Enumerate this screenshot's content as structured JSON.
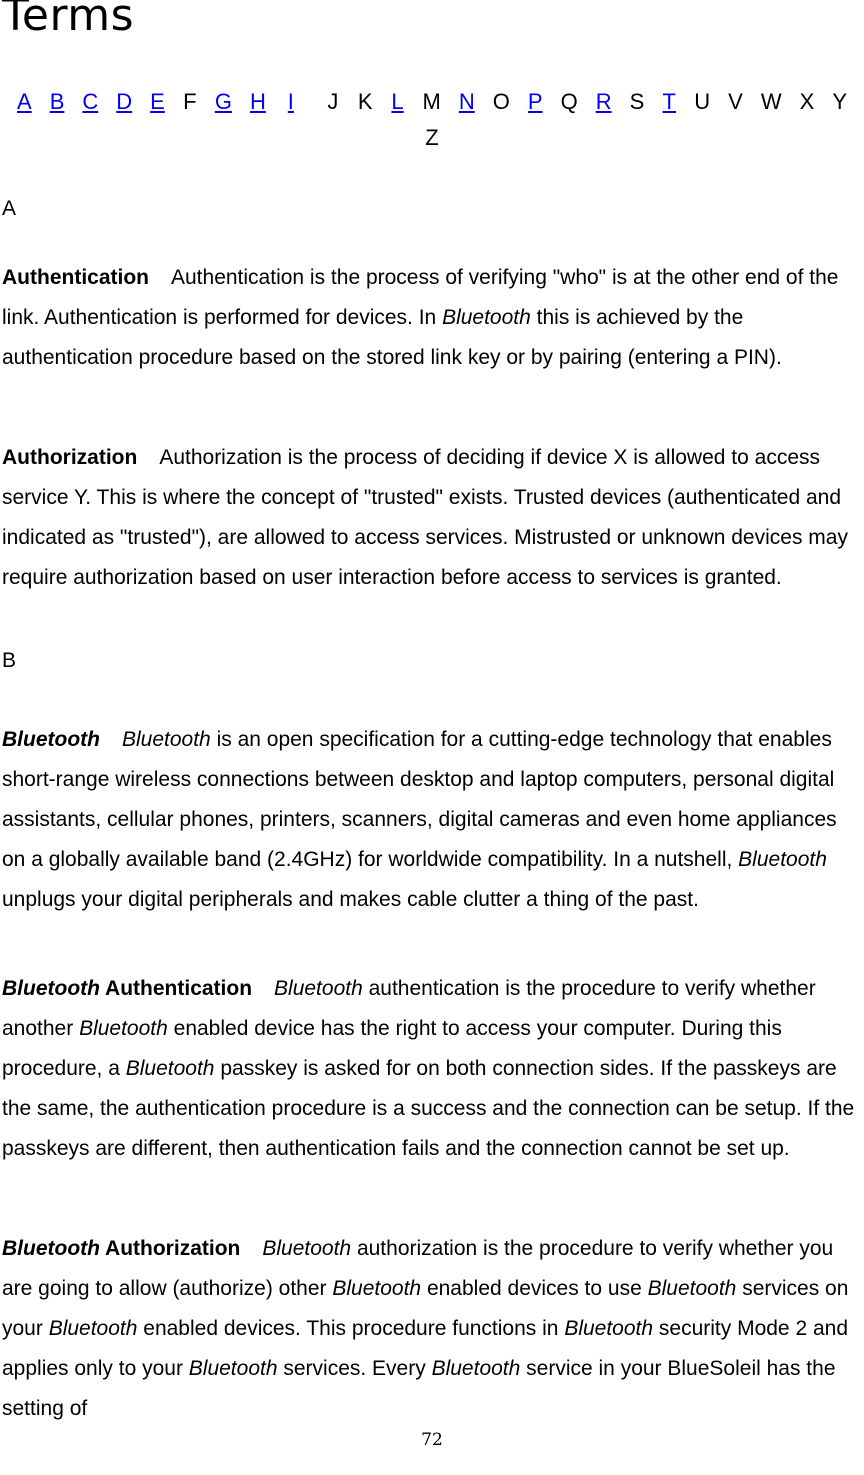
{
  "document": {
    "title": "Terms",
    "page_number": "72",
    "link_color": "#0000ee",
    "text_color": "#000000",
    "background_color": "#ffffff"
  },
  "alphabet_index": {
    "name": "alphabet-index",
    "letters": [
      {
        "label": "A",
        "is_link": true
      },
      {
        "label": "B",
        "is_link": true
      },
      {
        "label": "C",
        "is_link": true
      },
      {
        "label": "D",
        "is_link": true
      },
      {
        "label": "E",
        "is_link": true
      },
      {
        "label": "F",
        "is_link": false
      },
      {
        "label": "G",
        "is_link": true
      },
      {
        "label": "H",
        "is_link": true
      },
      {
        "label": "I",
        "is_link": true
      },
      {
        "label": "J",
        "is_link": false
      },
      {
        "label": "K",
        "is_link": false
      },
      {
        "label": "L",
        "is_link": true
      },
      {
        "label": "M",
        "is_link": false
      },
      {
        "label": "N",
        "is_link": true
      },
      {
        "label": "O",
        "is_link": false
      },
      {
        "label": "P",
        "is_link": true
      },
      {
        "label": "Q",
        "is_link": false
      },
      {
        "label": "R",
        "is_link": true
      },
      {
        "label": "S",
        "is_link": false
      },
      {
        "label": "T",
        "is_link": true
      },
      {
        "label": "U",
        "is_link": false
      },
      {
        "label": "V",
        "is_link": false
      },
      {
        "label": "W",
        "is_link": false
      },
      {
        "label": "X",
        "is_link": false
      },
      {
        "label": "Y",
        "is_link": false
      },
      {
        "label": "Z",
        "is_link": false
      }
    ]
  },
  "sections": {
    "a": {
      "heading": "A"
    },
    "b": {
      "heading": "B"
    }
  },
  "entries": {
    "authentication": {
      "term": "Authentication",
      "body_1": "Authentication is the process of verifying \"who\" is at the other end of the link. Authentication is performed for devices. In ",
      "italic_1": "Bluetooth",
      "body_2": " this is achieved by the authentication procedure based on the stored link key or by pairing (entering a PIN)."
    },
    "authorization": {
      "term": "Authorization",
      "body_1": "Authorization is the process of deciding if device X is allowed to access service Y. This is where the concept of \"trusted\" exists. Trusted devices (authenticated and indicated as \"trusted\"), are allowed to access services. Mistrusted or unknown devices may require authorization based on user interaction before access to services is granted."
    },
    "bluetooth": {
      "term_italic": "Bluetooth",
      "italic_1": "Bluetooth",
      "body_1": " is an open specification for a cutting-edge technology that enables short-range wireless connections between desktop and laptop computers, personal digital assistants, cellular phones, printers, scanners, digital cameras and even home appliances on a globally available band (2.4GHz) for worldwide compatibility. In a nutshell, ",
      "italic_2": "Bluetooth",
      "body_2": " unplugs your digital peripherals and makes cable clutter a thing of the past."
    },
    "bluetooth_authentication": {
      "term_italic": "Bluetooth",
      "term_bold": " Authentication",
      "italic_1": "Bluetooth",
      "body_1": " authentication is the procedure to verify whether another ",
      "italic_2": "Bluetooth",
      "body_2": " enabled device has the right to access your computer. During this procedure, a ",
      "italic_3": "Bluetooth",
      "body_3": " passkey is asked for on both connection sides. If the passkeys are the same, the authentication procedure is a success and the connection can be setup. If the passkeys are different, then authentication fails and the connection cannot be set up."
    },
    "bluetooth_authorization": {
      "term_italic": "Bluetooth",
      "term_bold": " Authorization",
      "italic_1": "Bluetooth",
      "body_1": " authorization is the procedure to verify whether you are going to allow (authorize) other ",
      "italic_2": "Bluetooth",
      "body_2": " enabled devices to use ",
      "italic_3": "Bluetooth",
      "body_3": " services on your ",
      "italic_4": "Bluetooth",
      "body_4": " enabled devices. This procedure functions in ",
      "italic_5": "Bluetooth",
      "body_5": " security Mode 2 and applies only to your ",
      "italic_6": "Bluetooth",
      "body_6": " services. Every ",
      "italic_7": "Bluetooth",
      "body_7": " service in your BlueSoleil has the setting of"
    }
  }
}
